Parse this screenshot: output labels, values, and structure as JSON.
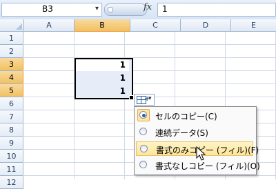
{
  "formula_bar": {
    "name_box": "B3",
    "fx_label": "fx",
    "formula_value": "1"
  },
  "columns": [
    "A",
    "B",
    "C",
    "D",
    "E"
  ],
  "selected_column": "B",
  "rows": [
    "1",
    "2",
    "3",
    "4",
    "5",
    "6",
    "7",
    "8",
    "9",
    "10",
    "11",
    "12"
  ],
  "selected_rows": [
    "3",
    "4",
    "5"
  ],
  "cells": [
    {
      "ref": "B3",
      "value": "1"
    },
    {
      "ref": "B4",
      "value": "1"
    },
    {
      "ref": "B5",
      "value": "1"
    }
  ],
  "autofill_menu": {
    "icon": "auto-fill-options-icon",
    "items": [
      {
        "label": "セルのコピー(C)",
        "selected": true,
        "highlighted": false
      },
      {
        "label": "連続データ(S)",
        "selected": false,
        "highlighted": false
      },
      {
        "label": "書式のみコピー (フィル)(F)",
        "selected": false,
        "highlighted": true
      },
      {
        "label": "書式なしコピー (フィル)(O)",
        "selected": false,
        "highlighted": false
      }
    ]
  }
}
